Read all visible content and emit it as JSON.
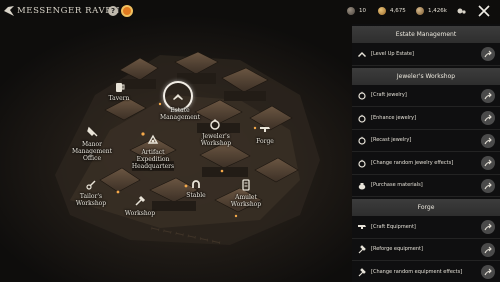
{
  "header": {
    "title": "MESSENGER RAVEN",
    "currencies": [
      {
        "name": "silver-coin",
        "value": "10"
      },
      {
        "name": "gold-coin",
        "value": "4,675"
      },
      {
        "name": "crown-coin",
        "value": "1,426k"
      }
    ]
  },
  "map": {
    "locations": [
      {
        "id": "tavern",
        "label": "Tavern"
      },
      {
        "id": "estate",
        "label": "Estate\nManagement"
      },
      {
        "id": "jeweler",
        "label": "Jeweler's\nWorkshop"
      },
      {
        "id": "forge",
        "label": "Forge"
      },
      {
        "id": "manor",
        "label": "Manor\nManagement\nOffice"
      },
      {
        "id": "artifact",
        "label": "Artifact\nExpedition\nHeadquarters"
      },
      {
        "id": "tailor",
        "label": "Tailor's\nWorkshop"
      },
      {
        "id": "workshop",
        "label": "Workshop"
      },
      {
        "id": "stable",
        "label": "Stable"
      },
      {
        "id": "amulet",
        "label": "Amulet\nWorkshop"
      }
    ]
  },
  "panel": {
    "sections": [
      {
        "title": "Estate Management",
        "rows": [
          "[Level Up Estate]"
        ]
      },
      {
        "title": "Jeweler's Workshop",
        "rows": [
          "[Craft jewelry]",
          "[Enhance jewelry]",
          "[Recast jewelry]",
          "[Change random jewelry effects]",
          "[Purchase materials]"
        ]
      },
      {
        "title": "Forge",
        "rows": [
          "[Craft Equipment]",
          "[Reforge equipment]",
          "[Change random equipment effects]"
        ]
      }
    ]
  },
  "colors": {
    "accent": "#e07a20",
    "panel_bg": "#0f0f10",
    "header_bg": "#333333"
  }
}
